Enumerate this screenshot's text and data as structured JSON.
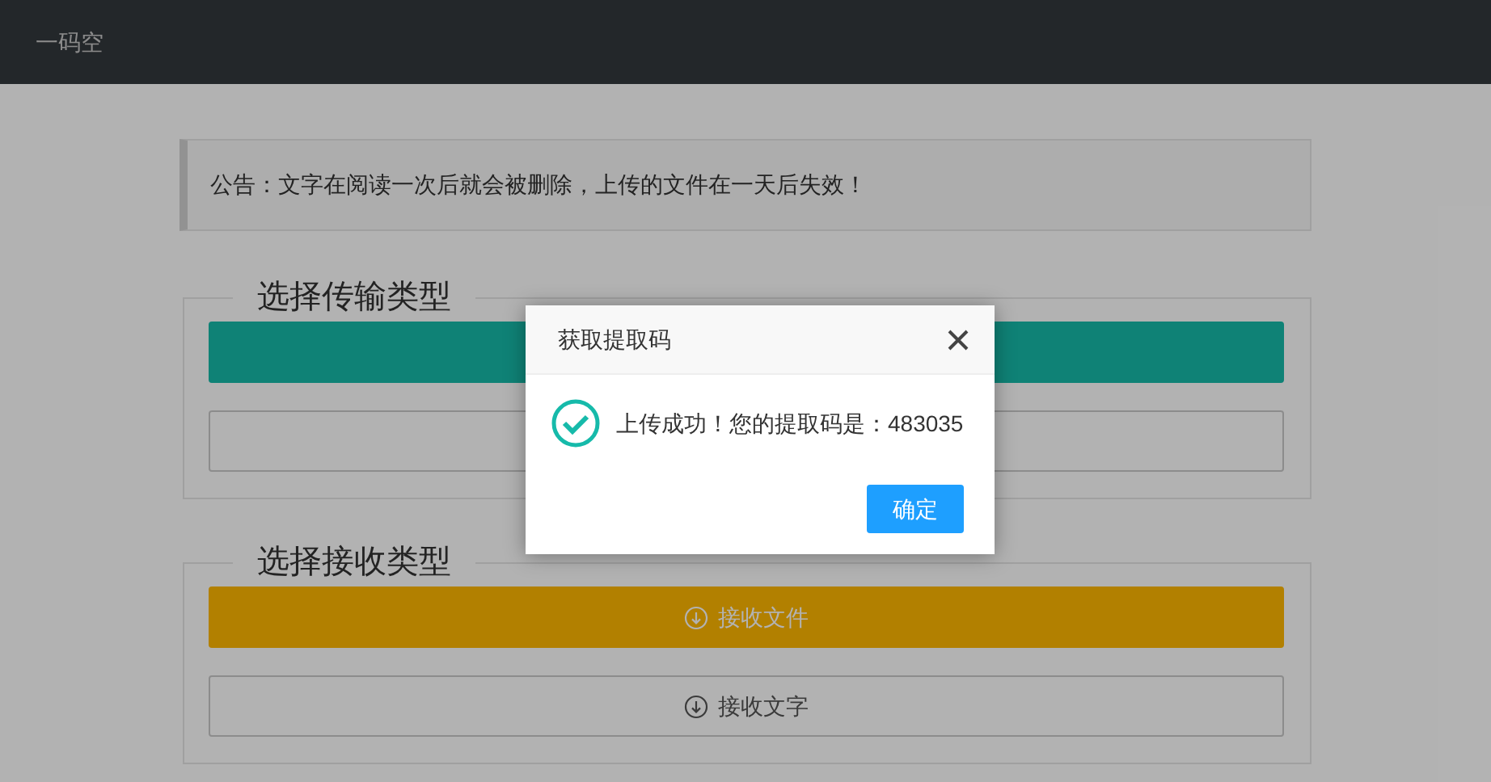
{
  "header": {
    "title": "一码空"
  },
  "notice": {
    "text": "公告：文字在阅读一次后就会被删除，上传的文件在一天后失效！"
  },
  "sections": [
    {
      "legend": "选择传输类型",
      "buttons": [
        {
          "kind": "teal"
        },
        {
          "kind": "plain"
        }
      ]
    },
    {
      "legend": "选择接收类型",
      "buttons": [
        {
          "kind": "warm",
          "label": "接收文件"
        },
        {
          "kind": "plain",
          "label": "接收文字"
        }
      ]
    }
  ],
  "dialog": {
    "title": "获取提取码",
    "message": "上传成功！您的提取码是：483035",
    "button": "确定"
  }
}
